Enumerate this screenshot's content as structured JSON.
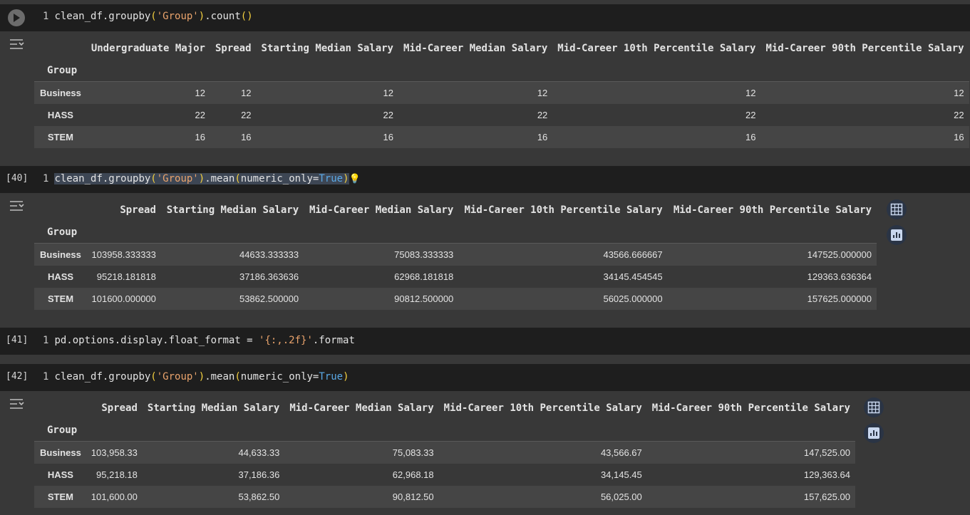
{
  "cells": [
    {
      "prompt": "",
      "line_no": "1",
      "code": {
        "obj": "clean_df.groupby",
        "arg": "'Group'",
        "tail": ".count",
        "call": "()"
      },
      "table": {
        "index_name": "Group",
        "columns": [
          "Undergraduate Major",
          "Spread",
          "Starting Median Salary",
          "Mid-Career Median Salary",
          "Mid-Career 10th Percentile Salary",
          "Mid-Career 90th Percentile Salary"
        ],
        "rows": [
          {
            "index": "Business",
            "values": [
              "12",
              "12",
              "12",
              "12",
              "12",
              "12"
            ]
          },
          {
            "index": "HASS",
            "values": [
              "22",
              "22",
              "22",
              "22",
              "22",
              "22"
            ]
          },
          {
            "index": "STEM",
            "values": [
              "16",
              "16",
              "16",
              "16",
              "16",
              "16"
            ]
          }
        ]
      }
    },
    {
      "prompt": "[40]",
      "line_no": "1",
      "code": {
        "obj": "clean_df.groupby",
        "arg": "'Group'",
        "tail": ".mean",
        "kwarg": "numeric_only=",
        "val": "True"
      },
      "table": {
        "index_name": "Group",
        "columns": [
          "Spread",
          "Starting Median Salary",
          "Mid-Career Median Salary",
          "Mid-Career 10th Percentile Salary",
          "Mid-Career 90th Percentile Salary"
        ],
        "rows": [
          {
            "index": "Business",
            "values": [
              "103958.333333",
              "44633.333333",
              "75083.333333",
              "43566.666667",
              "147525.000000"
            ]
          },
          {
            "index": "HASS",
            "values": [
              "95218.181818",
              "37186.363636",
              "62968.181818",
              "34145.454545",
              "129363.636364"
            ]
          },
          {
            "index": "STEM",
            "values": [
              "101600.000000",
              "53862.500000",
              "90812.500000",
              "56025.000000",
              "157625.000000"
            ]
          }
        ]
      }
    },
    {
      "prompt": "[41]",
      "line_no": "1",
      "code": {
        "obj": "pd.options.display.float_format = ",
        "arg": "'{:,.2f}'",
        "tail": ".format"
      }
    },
    {
      "prompt": "[42]",
      "line_no": "1",
      "code": {
        "obj": "clean_df.groupby",
        "arg": "'Group'",
        "tail": ".mean",
        "kwarg": "numeric_only=",
        "val": "True"
      },
      "table": {
        "index_name": "Group",
        "columns": [
          "Spread",
          "Starting Median Salary",
          "Mid-Career Median Salary",
          "Mid-Career 10th Percentile Salary",
          "Mid-Career 90th Percentile Salary"
        ],
        "rows": [
          {
            "index": "Business",
            "values": [
              "103,958.33",
              "44,633.33",
              "75,083.33",
              "43,566.67",
              "147,525.00"
            ]
          },
          {
            "index": "HASS",
            "values": [
              "95,218.18",
              "37,186.36",
              "62,968.18",
              "34,145.45",
              "129,363.64"
            ]
          },
          {
            "index": "STEM",
            "values": [
              "101,600.00",
              "53,862.50",
              "90,812.50",
              "56,025.00",
              "157,625.00"
            ]
          }
        ]
      }
    }
  ],
  "icons": {
    "run": "play-icon",
    "output_toggle": "output-collapse-icon",
    "table_view": "table-icon",
    "chart_suggest": "bar-chart-icon",
    "hint": "lightbulb-icon"
  },
  "colors": {
    "string": "#e9a36c",
    "keyword": "#5aa9e6",
    "paren": "#f4d03f"
  }
}
